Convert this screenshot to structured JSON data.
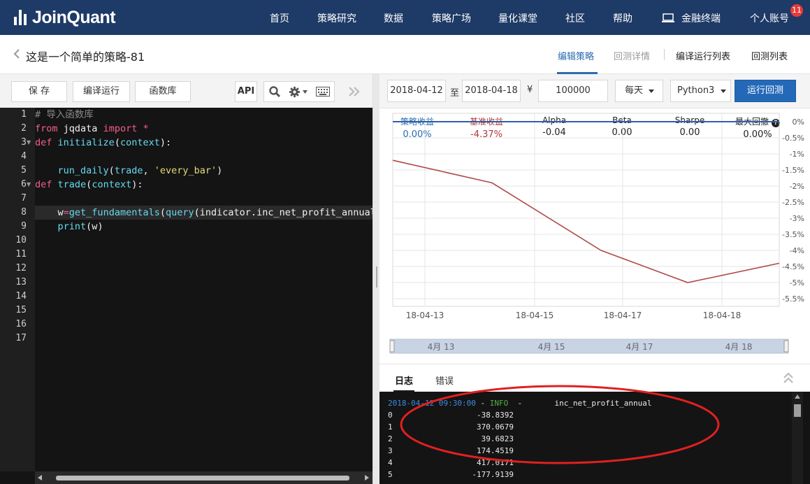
{
  "brand": {
    "name": "JoinQuant"
  },
  "nav": {
    "items": [
      "首页",
      "策略研究",
      "数据",
      "策略广场",
      "量化课堂",
      "社区",
      "帮助",
      "金融终端",
      "个人账号"
    ],
    "notification_count": "11"
  },
  "page": {
    "title": "这是一个简单的策略-81",
    "tabs": [
      "编辑策略",
      "回测详情",
      "编译运行列表",
      "回测列表"
    ],
    "active_tab": "编辑策略"
  },
  "editor_toolbar": {
    "save_label": "保 存",
    "compile_label": "编译运行",
    "library_label": "函数库",
    "api_label": "API"
  },
  "code": {
    "line_numbers": [
      "1",
      "2",
      "3",
      "4",
      "5",
      "6",
      "7",
      "8",
      "9",
      "10",
      "11",
      "12",
      "13",
      "14",
      "15",
      "16",
      "17"
    ],
    "lines": [
      "# 导入函数库",
      "from jqdata import *",
      "def initialize(context):",
      "",
      "    run_daily(trade, 'every_bar')",
      "def trade(context):",
      "",
      "    w=get_fundamentals(query(indicator.inc_net_profit_annual))",
      "    print(w)"
    ]
  },
  "backtest": {
    "start_date": "2018-04-12",
    "to_label": "至",
    "end_date": "2018-04-18",
    "currency_symbol": "¥",
    "capital": "100000",
    "frequency": "每天",
    "language": "Python3",
    "run_label": "运行回测"
  },
  "metrics": [
    {
      "label": "策略收益",
      "value": "0.00%",
      "color": "#2b6cb0"
    },
    {
      "label": "基准收益",
      "value": "-4.37%",
      "color": "#b03a3a"
    },
    {
      "label": "Alpha",
      "value": "-0.04",
      "color": "#222222"
    },
    {
      "label": "Beta",
      "value": "0.00",
      "color": "#222222"
    },
    {
      "label": "Sharpe",
      "value": "0.00",
      "color": "#222222"
    },
    {
      "label": "最大回撤",
      "value": "0.00%",
      "color": "#222222"
    }
  ],
  "chart_data": {
    "type": "line",
    "title": "",
    "xlabel": "",
    "ylabel": "",
    "x_ticks": [
      "18-04-13",
      "18-04-15",
      "18-04-17",
      "18-04-18"
    ],
    "x": [
      "2018-04-12",
      "2018-04-13",
      "2018-04-16",
      "2018-04-17",
      "2018-04-18"
    ],
    "y_ticks": [
      "0%",
      "-0.5%",
      "-1%",
      "-1.5%",
      "-2%",
      "-2.5%",
      "-3%",
      "-3.5%",
      "-4%",
      "-4.5%",
      "-5%",
      "-5.5%"
    ],
    "ylim": [
      -5.5,
      0
    ],
    "grid": true,
    "series": [
      {
        "color": "#2f5fa8",
        "values": [
          0,
          0,
          0,
          0,
          0
        ]
      },
      {
        "color": "#b04a4a",
        "values": [
          -1.2,
          -1.9,
          -4.0,
          -5.0,
          -4.4
        ]
      }
    ],
    "navigator_labels": [
      "4月 13",
      "4月 15",
      "4月 17",
      "4月 18"
    ]
  },
  "log": {
    "tabs": [
      "日志",
      "错误"
    ],
    "header_time": "2018-04-12 09:30:00",
    "header_sep": " - ",
    "header_level": "INFO",
    "header_tail": "  -       inc_net_profit_annual",
    "rows": [
      {
        "idx": "0",
        "val": "-38.8392"
      },
      {
        "idx": "1",
        "val": "370.0679"
      },
      {
        "idx": "2",
        "val": "39.6823"
      },
      {
        "idx": "3",
        "val": "174.4519"
      },
      {
        "idx": "4",
        "val": "417.0171"
      },
      {
        "idx": "5",
        "val": "-177.9139"
      }
    ]
  }
}
